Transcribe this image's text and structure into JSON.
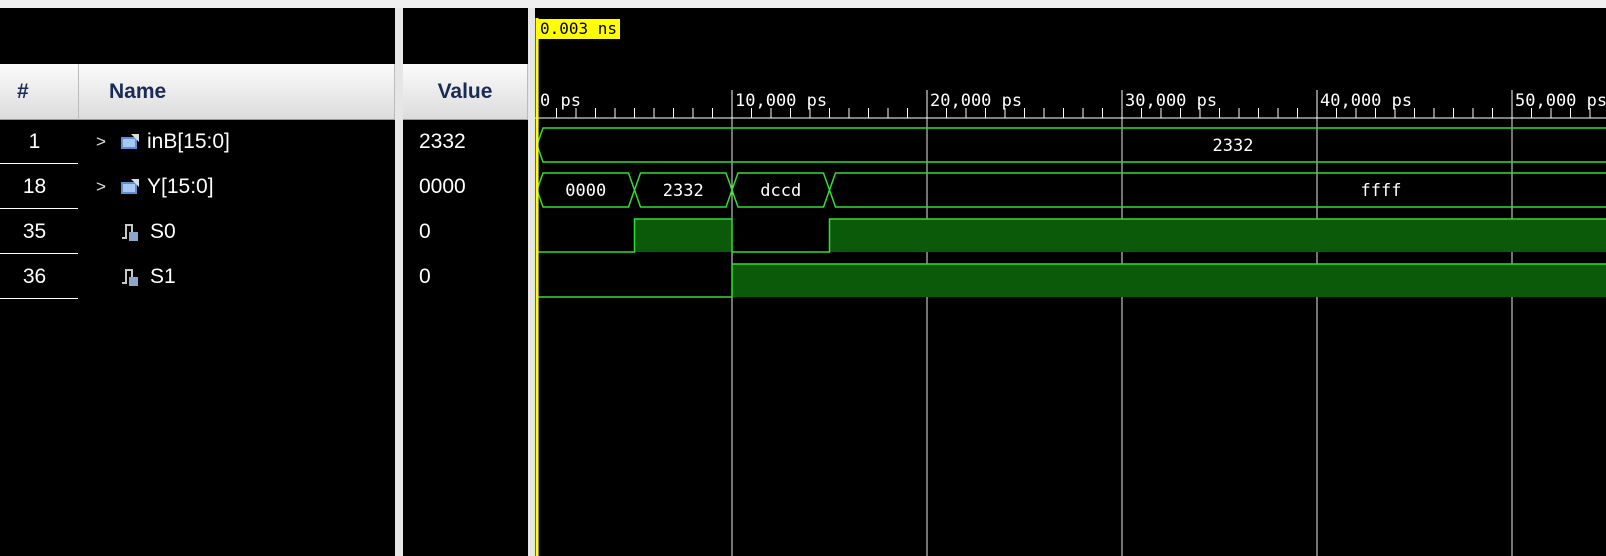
{
  "columns": {
    "num": "#",
    "name": "Name",
    "value": "Value"
  },
  "signals": [
    {
      "num": "1",
      "name": "inB[15:0]",
      "value": "2332",
      "type": "bus",
      "expandable": true
    },
    {
      "num": "18",
      "name": "Y[15:0]",
      "value": "0000",
      "type": "bus",
      "expandable": true
    },
    {
      "num": "35",
      "name": "S0",
      "value": "0",
      "type": "bit",
      "expandable": false
    },
    {
      "num": "36",
      "name": "S1",
      "value": "0",
      "type": "bit",
      "expandable": false
    }
  ],
  "cursor": {
    "label": "0.003 ns",
    "time_ps": 3
  },
  "timeline": {
    "ticks": [
      {
        "t": 0,
        "label": "0 ps"
      },
      {
        "t": 10000,
        "label": "10,000 ps"
      },
      {
        "t": 20000,
        "label": "20,000 ps"
      },
      {
        "t": 30000,
        "label": "30,000 ps"
      },
      {
        "t": 40000,
        "label": "40,000 ps"
      },
      {
        "t": 50000,
        "label": "50,000 ps"
      }
    ]
  },
  "waves": {
    "inB": [
      {
        "from": 0,
        "to": 60000,
        "label": "2332"
      }
    ],
    "Y": [
      {
        "from": 0,
        "to": 5000,
        "label": "0000"
      },
      {
        "from": 5000,
        "to": 10000,
        "label": "2332"
      },
      {
        "from": 10000,
        "to": 15000,
        "label": "dccd"
      },
      {
        "from": 15000,
        "to": 60000,
        "label": "ffff"
      }
    ],
    "S0": [
      {
        "t": 0,
        "v": 0
      },
      {
        "t": 5000,
        "v": 1
      },
      {
        "t": 10000,
        "v": 0
      },
      {
        "t": 15000,
        "v": 1
      }
    ],
    "S1": [
      {
        "t": 0,
        "v": 0
      },
      {
        "t": 10000,
        "v": 1
      }
    ]
  },
  "colors": {
    "wave": "#33dd33",
    "high_fill": "#0a5a0a",
    "cursor": "#ffff00",
    "grid": "#ffffff"
  }
}
